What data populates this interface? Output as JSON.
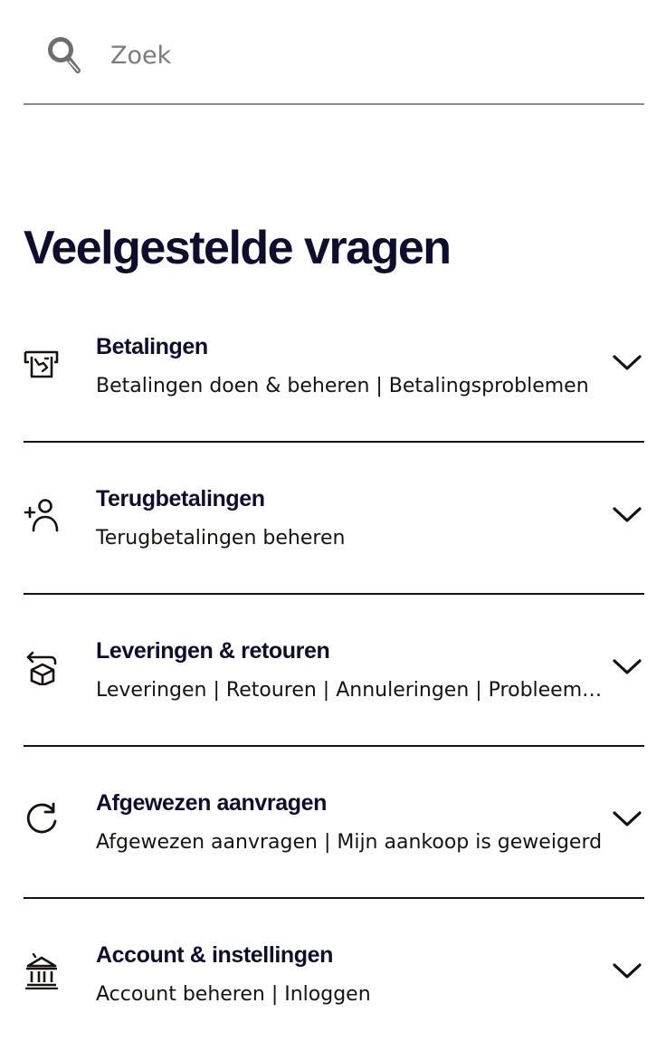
{
  "search": {
    "placeholder": "Zoek",
    "icon": "search-icon"
  },
  "page": {
    "title": "Veelgestelde vragen"
  },
  "faq": {
    "items": [
      {
        "icon": "payment-card-icon",
        "title": "Betalingen",
        "subtitle": "Betalingen doen & beheren | Betalingsproblemen"
      },
      {
        "icon": "person-add-icon",
        "title": "Terugbetalingen",
        "subtitle": "Terugbetalingen beheren"
      },
      {
        "icon": "package-return-icon",
        "title": "Leveringen & retouren",
        "subtitle": "Leveringen | Retouren | Annuleringen | Probleem met bestelling"
      },
      {
        "icon": "refresh-icon",
        "title": "Afgewezen aanvragen",
        "subtitle": "Afgewezen aanvragen | Mijn aankoop is geweigerd"
      },
      {
        "icon": "bank-icon",
        "title": "Account & instellingen",
        "subtitle": "Account beheren | Inloggen"
      }
    ],
    "expand_icon": "chevron-down-icon"
  },
  "colors": {
    "text": "#17120f",
    "heading": "#0e0e2c",
    "divider": "#17120f",
    "search_border": "#8a8a8a",
    "placeholder": "#7b7b7b",
    "background": "#ffffff"
  }
}
